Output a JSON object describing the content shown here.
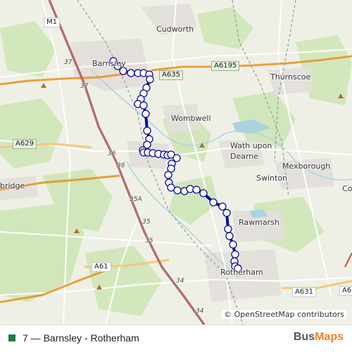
{
  "map": {
    "places": [
      "Barnsley",
      "Cudworth",
      "Thurnscoe",
      "Wombwell",
      "Wath upon Dearne",
      "Mexborough",
      "Swinton",
      "Rawmarsh",
      "Rotherham",
      "bridge",
      "Co"
    ],
    "road_labels": [
      "M1",
      "A635",
      "A6195",
      "A629",
      "A61",
      "A631",
      "A6"
    ],
    "junction_labels": [
      "37",
      "37",
      "36",
      "36",
      "35A",
      "35",
      "35",
      "34",
      "34"
    ],
    "route_color": "#0a0a9c",
    "stop_fill": "#ffffff",
    "stop_stroke": "#0a0a9c",
    "stop_count": 46
  },
  "attribution": "© OpenStreetMap contributors",
  "legend": {
    "color": "#1e7a4a",
    "label": "7 — Barnsley - Rotherham"
  },
  "brand": {
    "part1": "Bus",
    "part2": "Maps"
  }
}
